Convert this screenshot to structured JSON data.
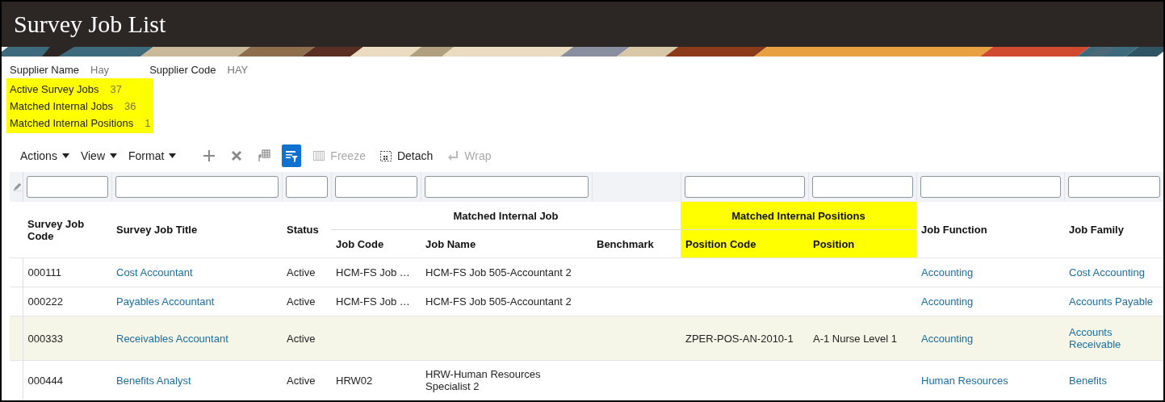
{
  "page": {
    "title": "Survey Job List"
  },
  "supplier": [
    {
      "label": "Supplier Name",
      "value": "Hay"
    },
    {
      "label": "Supplier Code",
      "value": "HAY"
    }
  ],
  "counts": {
    "highlighted": true,
    "items": [
      {
        "label": "Active Survey Jobs",
        "value": "37"
      },
      {
        "label": "Matched Internal Jobs",
        "value": "36"
      },
      {
        "label": "Matched Internal Positions",
        "value": "1"
      }
    ]
  },
  "toolbar": {
    "menus": [
      {
        "label": "Actions"
      },
      {
        "label": "View"
      },
      {
        "label": "Format"
      }
    ],
    "tools": [
      {
        "kind": "add",
        "disabled": false
      },
      {
        "kind": "delete",
        "disabled": false
      },
      {
        "kind": "export",
        "disabled": false
      },
      {
        "kind": "filter",
        "on": true,
        "disabled": false
      },
      {
        "kind": "freeze",
        "label": "Freeze",
        "disabled": true
      },
      {
        "kind": "detach",
        "label": "Detach",
        "disabled": false
      },
      {
        "kind": "wrap",
        "label": "Wrap",
        "disabled": true
      }
    ]
  },
  "table": {
    "header": [
      {
        "label": "Survey Job Code"
      },
      {
        "label": "Survey Job Title"
      },
      {
        "label": "Status"
      },
      {
        "group": "Matched Internal Job",
        "highlighted": false,
        "columns": [
          {
            "label": "Job Code"
          },
          {
            "label": "Job Name"
          },
          {
            "label": "Benchmark"
          }
        ]
      },
      {
        "group": "Matched Internal Positions",
        "highlighted": true,
        "columns": [
          {
            "label": "Position Code"
          },
          {
            "label": "Position"
          }
        ]
      },
      {
        "label": "Job Function"
      },
      {
        "label": "Job Family"
      }
    ],
    "columns": [
      {
        "kind": "text",
        "filter": true
      },
      {
        "kind": "link",
        "filter": true
      },
      {
        "kind": "text",
        "filter": true
      },
      {
        "kind": "text",
        "filter": true
      },
      {
        "kind": "text",
        "filter": true
      },
      {
        "kind": "text",
        "filter": false
      },
      {
        "kind": "text",
        "filter": true
      },
      {
        "kind": "text",
        "filter": true
      },
      {
        "kind": "link",
        "filter": true
      },
      {
        "kind": "link",
        "filter": true
      }
    ],
    "rows": [
      {
        "selected": false,
        "cells": [
          "000111",
          "Cost Accountant",
          "Active",
          "HCM-FS Job …",
          "HCM-FS Job 505-Accountant 2",
          "",
          "",
          "",
          "Accounting",
          "Cost Accounting"
        ]
      },
      {
        "selected": false,
        "cells": [
          "000222",
          "Payables Accountant",
          "Active",
          "HCM-FS Job …",
          "HCM-FS Job 505-Accountant 2",
          "",
          "",
          "",
          "Accounting",
          "Accounts Payable"
        ]
      },
      {
        "selected": true,
        "cells": [
          "000333",
          "Receivables Accountant",
          "Active",
          "",
          "",
          "",
          "ZPER-POS-AN-2010-1",
          "A-1 Nurse Level 1",
          "Accounting",
          "Accounts Receivable"
        ]
      },
      {
        "selected": false,
        "cells": [
          "000444",
          "Benefits Analyst",
          "Active",
          "HRW02",
          "HRW-Human Resources Specialist 2",
          "",
          "",
          "",
          "Human Resources",
          "Benefits"
        ]
      }
    ]
  }
}
